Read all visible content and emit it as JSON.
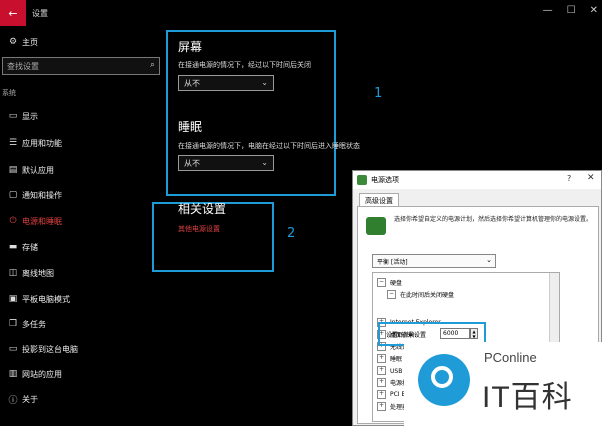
{
  "window": {
    "title": "设置",
    "controls": [
      "—",
      "☐",
      "✕"
    ]
  },
  "sidebar": {
    "home_label": "主页",
    "search_placeholder": "查找设置",
    "section_label": "系统",
    "items": [
      {
        "label": "显示",
        "icon": "display-icon",
        "active": false
      },
      {
        "label": "应用和功能",
        "icon": "apps-icon",
        "active": false
      },
      {
        "label": "默认应用",
        "icon": "default-apps-icon",
        "active": false
      },
      {
        "label": "通知和操作",
        "icon": "notification-icon",
        "active": false
      },
      {
        "label": "电源和睡眠",
        "icon": "power-icon",
        "active": true
      },
      {
        "label": "存储",
        "icon": "storage-icon",
        "active": false
      },
      {
        "label": "离线地图",
        "icon": "map-icon",
        "active": false
      },
      {
        "label": "平板电脑模式",
        "icon": "tablet-icon",
        "active": false
      },
      {
        "label": "多任务",
        "icon": "multitask-icon",
        "active": false
      },
      {
        "label": "投影到这台电脑",
        "icon": "project-icon",
        "active": false
      },
      {
        "label": "网站的应用",
        "icon": "web-apps-icon",
        "active": false
      },
      {
        "label": "关于",
        "icon": "info-icon",
        "active": false
      }
    ]
  },
  "main": {
    "screen": {
      "heading": "屏幕",
      "description": "在接通电源的情况下，经过以下时间后关闭",
      "value": "从不"
    },
    "sleep": {
      "heading": "睡眠",
      "description": "在接通电源的情况下，电脑在经过以下时间后进入睡眠状态",
      "value": "从不"
    },
    "related": {
      "heading": "相关设置",
      "link": "其他电源设置"
    },
    "callouts": [
      "1",
      "2"
    ]
  },
  "power_options": {
    "title": "电源选项",
    "tab": "高级设置",
    "description": "选择你希望自定义的电源计划，然后选择你希望计算机管理你的电源设置。",
    "plan": "平衡 [活动]",
    "tree": [
      {
        "label": "硬盘",
        "expander": "−"
      },
      {
        "label": "在此时间后关闭硬盘",
        "expander": "−"
      },
      {
        "label": "Internet Explorer",
        "expander": "+"
      },
      {
        "label": "桌面背景设置",
        "expander": "+"
      },
      {
        "label": "无线适配器设置",
        "expander": "+"
      },
      {
        "label": "睡眠",
        "expander": "+"
      },
      {
        "label": "USB 设置",
        "expander": "+"
      },
      {
        "label": "电源按钮",
        "expander": "+"
      },
      {
        "label": "PCI Ex",
        "expander": "+"
      },
      {
        "label": "处理器",
        "expander": "+"
      }
    ],
    "setting_label": "设置(分钟):",
    "setting_value": "6000"
  },
  "watermark": {
    "top": "PConline",
    "brand": "IT百科"
  }
}
